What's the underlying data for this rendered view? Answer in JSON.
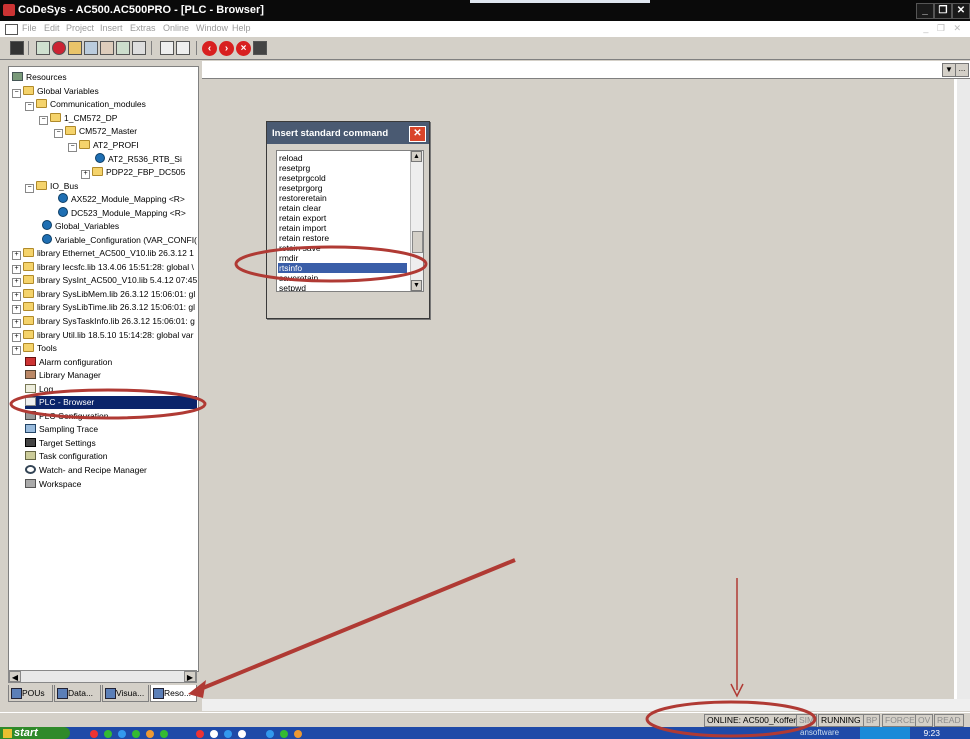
{
  "window": {
    "title": "CoDeSys - AC500.AC500PRO - [PLC - Browser]",
    "controls": [
      "_",
      "❐",
      "✕"
    ]
  },
  "menubar": [
    "File",
    "Edit",
    "Project",
    "Insert",
    "Extras",
    "Online",
    "Window",
    "Help"
  ],
  "mdi_controls": "_ ❐ ✕",
  "toolbar": {
    "icons": [
      "save-icon",
      "open-icon",
      "login-icon",
      "logout-icon",
      "run-icon",
      "stop-icon",
      "step-icon",
      "print-icon",
      "cut-icon",
      "copy-icon",
      "back-icon",
      "forward-icon",
      "cancel-icon",
      "disk-icon"
    ]
  },
  "tree": {
    "items": [
      {
        "label": "Resources"
      },
      {
        "label": "Global Variables"
      },
      {
        "label": "Communication_modules"
      },
      {
        "label": "1_CM572_DP"
      },
      {
        "label": "CM572_Master"
      },
      {
        "label": "AT2_PROFI"
      },
      {
        "label": "AT2_R536_RTB_Si"
      },
      {
        "label": "PDP22_FBP_DC505"
      },
      {
        "label": "IO_Bus"
      },
      {
        "label": "AX522_Module_Mapping <R>"
      },
      {
        "label": "DC523_Module_Mapping <R>"
      },
      {
        "label": "Global_Variables"
      },
      {
        "label": "Variable_Configuration (VAR_CONFI("
      },
      {
        "label": "library Ethernet_AC500_V10.lib 26.3.12 1"
      },
      {
        "label": "library Iecsfc.lib 13.4.06 15:51:28: global \\"
      },
      {
        "label": "library SysInt_AC500_V10.lib 5.4.12 07:45"
      },
      {
        "label": "library SysLibMem.lib 26.3.12 15:06:01: gl"
      },
      {
        "label": "library SysLibTime.lib 26.3.12 15:06:01: gl"
      },
      {
        "label": "library SysTaskInfo.lib 26.3.12 15:06:01: g"
      },
      {
        "label": "library Util.lib 18.5.10 15:14:28: global var"
      },
      {
        "label": "Tools"
      },
      {
        "label": "Alarm configuration"
      },
      {
        "label": "Library Manager"
      },
      {
        "label": "Log"
      },
      {
        "label": "PLC - Browser"
      },
      {
        "label": "PLC Configuration"
      },
      {
        "label": "Sampling Trace"
      },
      {
        "label": "Target Settings"
      },
      {
        "label": "Task configuration"
      },
      {
        "label": "Watch- and Recipe Manager"
      },
      {
        "label": "Workspace"
      }
    ],
    "selected": "PLC - Browser"
  },
  "tabs": [
    {
      "label": "POUs"
    },
    {
      "label": "Data..."
    },
    {
      "label": "Visua..."
    },
    {
      "label": "Reso..."
    }
  ],
  "dialog": {
    "title": "Insert standard command",
    "items": [
      "reload",
      "resetprg",
      "resetprgcold",
      "resetprgorg",
      "restoreretain",
      "retain clear",
      "retain export",
      "retain import",
      "retain restore",
      "retain save",
      "rmdir",
      "rtsinfo",
      "saveretain",
      "setpwd"
    ],
    "highlighted": "rtsinfo"
  },
  "statusbar": {
    "online": "ONLINE: AC500_Koffer",
    "sim": "SIM",
    "running": "RUNNING",
    "bp": "BP",
    "force": "FORCE",
    "ov": "OV",
    "read": "READ"
  },
  "taskbar": {
    "start": "start",
    "clock": "9:23",
    "tray_text": "ansoftware"
  },
  "annotation_color": "#b03a34"
}
